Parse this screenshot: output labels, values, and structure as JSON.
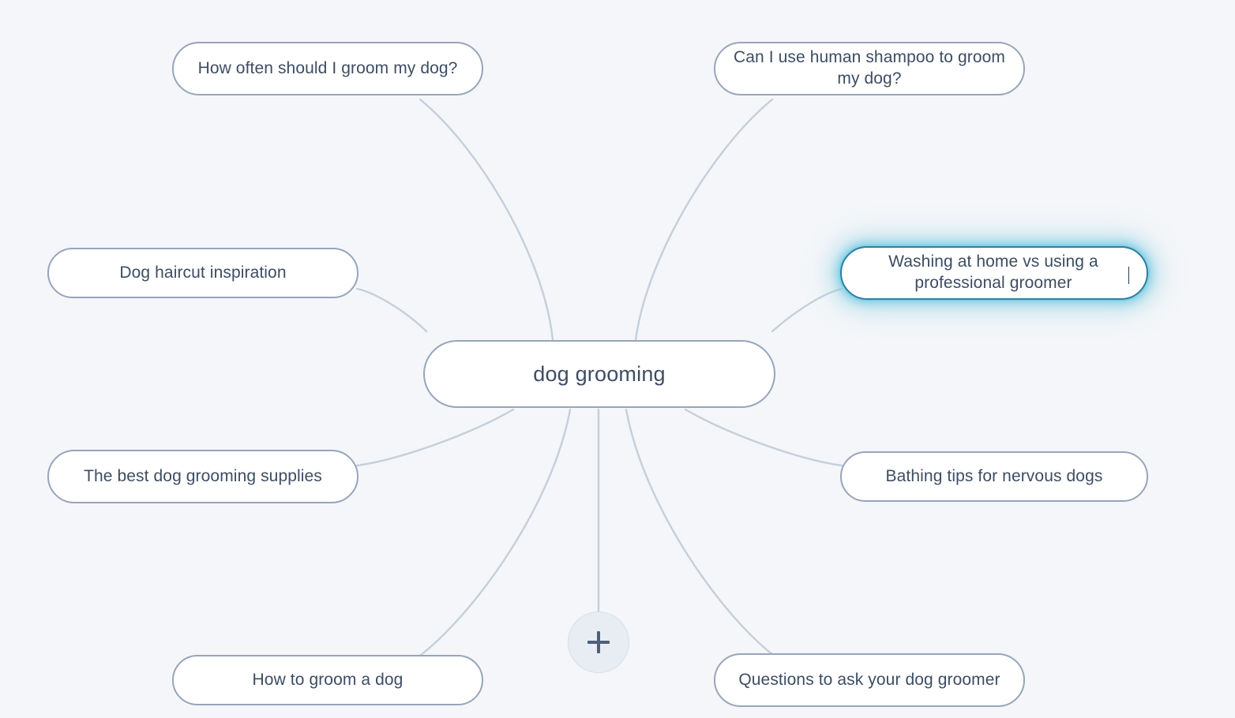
{
  "app": {
    "type": "mind-map",
    "background_color": "#f4f6f9",
    "connector_color": "#c5cfdc",
    "node_border_color": "#97a5bb",
    "node_fill_color": "#ffffff",
    "node_text_color": "#3d4d63",
    "focus_glow_color": "#6dc8e2",
    "focus_border_color": "#2e7f9e"
  },
  "center_node": {
    "label": "dog grooming"
  },
  "nodes": [
    {
      "id": "how-often-groom",
      "label": "How often should I groom my dog?",
      "focused": false
    },
    {
      "id": "human-shampoo",
      "label": "Can I use human shampoo to groom my dog?",
      "focused": false
    },
    {
      "id": "haircut-inspiration",
      "label": "Dog haircut inspiration",
      "focused": false
    },
    {
      "id": "washing-at-home",
      "label": "Washing at home vs using a professional groomer",
      "focused": true
    },
    {
      "id": "best-supplies",
      "label": "The best dog grooming supplies",
      "focused": false
    },
    {
      "id": "bathing-tips",
      "label": "Bathing tips for nervous dogs",
      "focused": false
    },
    {
      "id": "how-to-groom",
      "label": "How to groom a dog",
      "focused": false
    },
    {
      "id": "questions-to-ask",
      "label": "Questions to ask your dog groomer",
      "focused": false
    }
  ],
  "add_button": {
    "icon": "plus-icon",
    "label": "+"
  }
}
